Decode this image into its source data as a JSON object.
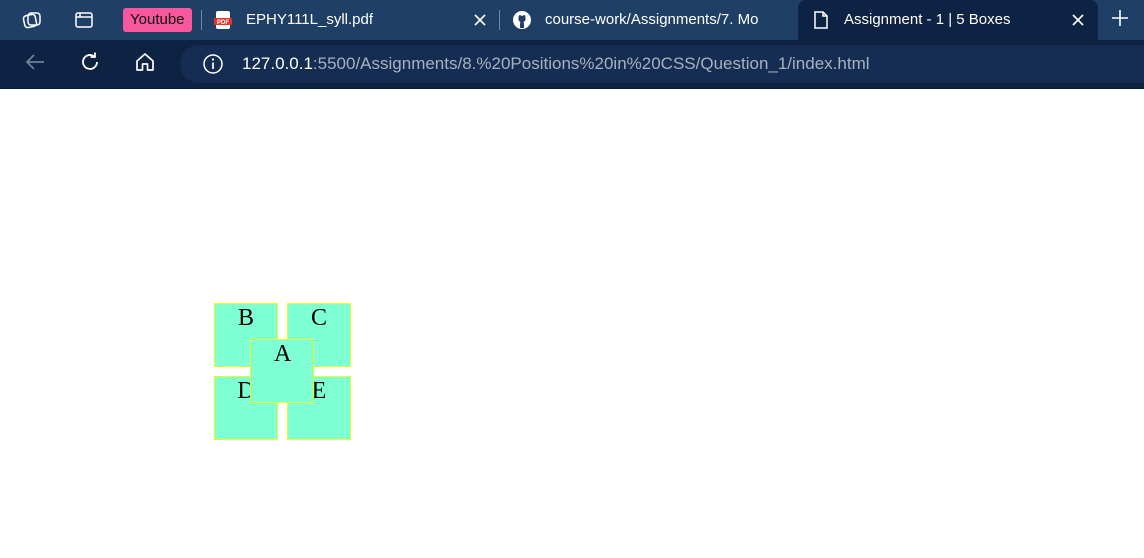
{
  "browser": {
    "tabs": [
      {
        "title": "Youtube",
        "kind": "bookmark-pill",
        "color": "#f7579c"
      },
      {
        "title": "EPHY111L_syll.pdf",
        "icon": "pdf-icon",
        "closable": true
      },
      {
        "title": "course-work/Assignments/7. Mo",
        "icon": "github-icon"
      },
      {
        "title": "Assignment - 1 | 5 Boxes",
        "icon": "page-icon",
        "active": true,
        "closable": true
      }
    ],
    "address": {
      "host": "127.0.0.1",
      "path": ":5500/Assignments/8.%20Positions%20in%20CSS/Question_1/index.html"
    },
    "colors": {
      "tabstrip": "#1f3f66",
      "toolbar": "#0e2343",
      "addressbar": "#152d52"
    }
  },
  "page": {
    "boxes": [
      {
        "label": "A",
        "fill": "#7fffd4",
        "border": "#e9ff1f"
      },
      {
        "label": "B",
        "fill": "#7fffd4",
        "border": "#e9ff1f"
      },
      {
        "label": "C",
        "fill": "#7fffd4",
        "border": "#e9ff1f"
      },
      {
        "label": "D",
        "fill": "#7fffd4",
        "border": "#e9ff1f"
      },
      {
        "label": "E",
        "fill": "#7fffd4",
        "border": "#e9ff1f"
      }
    ]
  }
}
